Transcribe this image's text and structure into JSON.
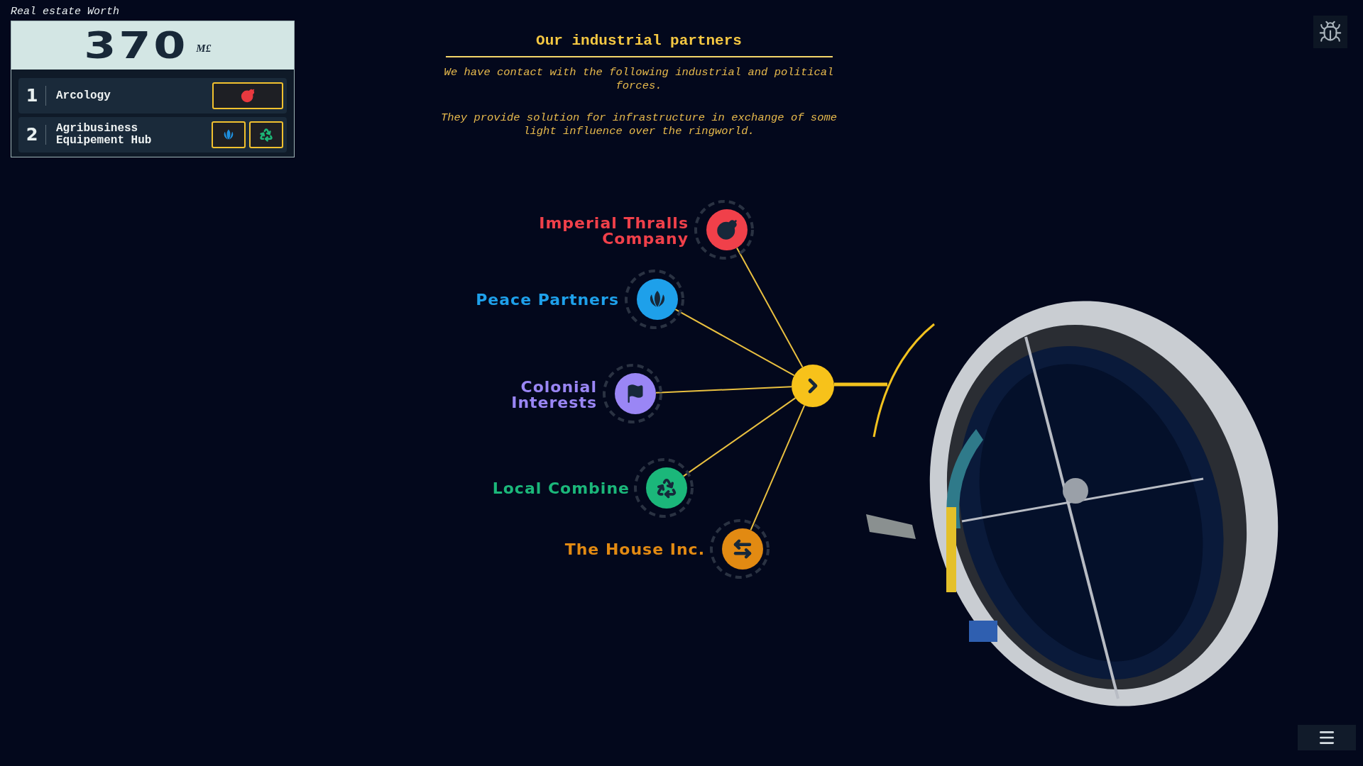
{
  "worth": {
    "label": "Real estate Worth",
    "value": "370",
    "unit": "M£"
  },
  "holdings": [
    {
      "rank": "1",
      "name": "Arcology",
      "slots": [
        {
          "kind": "bomb",
          "color": "#e8393f"
        }
      ]
    },
    {
      "rank": "2",
      "name": "Agribusiness Equipement Hub",
      "slots": [
        {
          "kind": "lotus",
          "color": "#1e90e0"
        },
        {
          "kind": "recycle",
          "color": "#1db878"
        }
      ]
    }
  ],
  "header": {
    "title": "Our industrial partners",
    "paragraphs": [
      "We have contact with the following industrial and political forces.",
      "They provide solution for infrastructure in exchange of some light influence over the ringworld."
    ]
  },
  "partners": [
    {
      "name": "Imperial Thralls Company",
      "kind": "bomb",
      "color": "#f0404a"
    },
    {
      "name": "Peace Partners",
      "kind": "lotus",
      "color": "#1ea0ea"
    },
    {
      "name": "Colonial Interests",
      "kind": "flag",
      "color": "#9a86f5"
    },
    {
      "name": "Local Combine",
      "kind": "recycle",
      "color": "#1bb77a"
    },
    {
      "name": "The House Inc.",
      "kind": "arrows",
      "color": "#e28a12"
    }
  ]
}
